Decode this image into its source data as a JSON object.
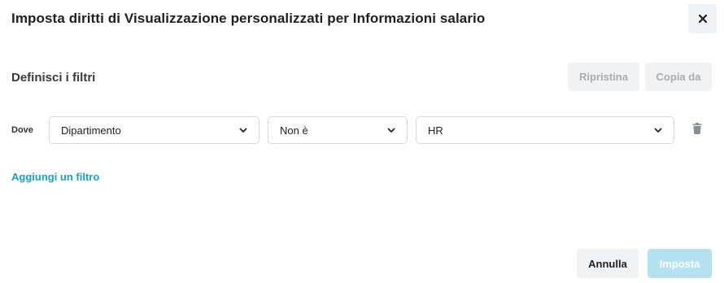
{
  "dialog": {
    "title": "Imposta diritti di Visualizzazione personalizzati per Informazioni salario",
    "close_icon": "close-icon"
  },
  "filters": {
    "section_title": "Definisci i filtri",
    "reset_label": "Ripristina",
    "copy_from_label": "Copia da",
    "rows": [
      {
        "where_label": "Dove",
        "field": "Dipartimento",
        "operator": "Non è",
        "value": "HR",
        "delete_icon": "trash-icon"
      }
    ],
    "add_filter_label": "Aggiungi un filtro"
  },
  "footer": {
    "cancel_label": "Annulla",
    "submit_label": "Imposta"
  },
  "colors": {
    "accent": "#17a2c8",
    "disabled_primary_bg": "#b5e2f0",
    "secondary_bg": "#f1f2f4",
    "disabled_text": "#a8acb3"
  }
}
